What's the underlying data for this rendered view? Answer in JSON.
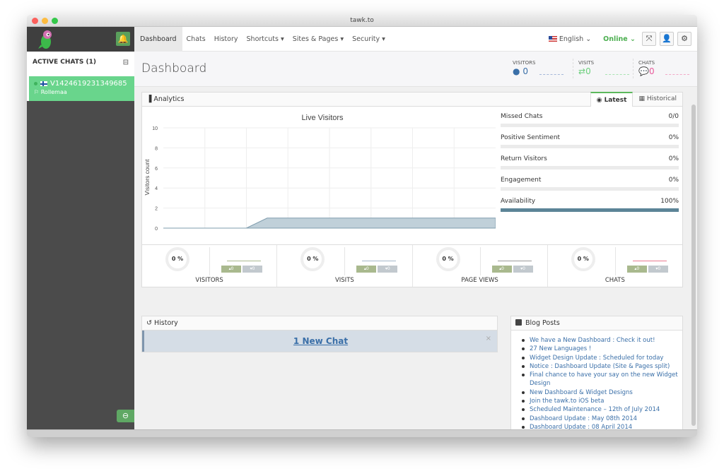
{
  "window": {
    "title": "tawk.to"
  },
  "sidebar": {
    "active_chats_label": "ACTIVE CHATS (1)",
    "chats": [
      {
        "id": "V1424619231349685",
        "location": "Rollemaa"
      }
    ]
  },
  "nav": {
    "items": [
      "Dashboard",
      "Chats",
      "History",
      "Shortcuts ▾",
      "Sites & Pages ▾",
      "Security ▾"
    ],
    "language": "English ⌄",
    "status": "Online ⌄"
  },
  "header": {
    "title": "Dashboard",
    "stats": [
      {
        "label": "VISITORS",
        "value": "0",
        "icon": "user-icon",
        "color": "#3a6fa8"
      },
      {
        "label": "VISITS",
        "value": "0",
        "icon": "exchange-icon",
        "color": "#6ccf7c"
      },
      {
        "label": "CHATS",
        "value": "0",
        "icon": "comments-icon",
        "color": "#e85a9b"
      }
    ]
  },
  "analytics": {
    "title": "Analytics",
    "tabs": [
      "Latest",
      "Historical"
    ],
    "metrics": [
      {
        "name": "Missed Chats",
        "value": "0/0",
        "fill": 0
      },
      {
        "name": "Positive Sentiment",
        "value": "0%",
        "fill": 0
      },
      {
        "name": "Return Visitors",
        "value": "0%",
        "fill": 0
      },
      {
        "name": "Engagement",
        "value": "0%",
        "fill": 0
      },
      {
        "name": "Availability",
        "value": "100%",
        "fill": 100
      }
    ],
    "summary": [
      {
        "label": "VISITORS",
        "percent": "0 %",
        "up": "▴0",
        "down": "▾0",
        "line_color": "#a9b98e"
      },
      {
        "label": "VISITS",
        "percent": "0 %",
        "up": "▴0",
        "down": "▾0",
        "line_color": "#a5b7c9"
      },
      {
        "label": "PAGE VIEWS",
        "percent": "0 %",
        "up": "▴0",
        "down": "▾0",
        "line_color": "#999999"
      },
      {
        "label": "CHATS",
        "percent": "0 %",
        "up": "▴0",
        "down": "▾0",
        "line_color": "#e8798f"
      }
    ]
  },
  "chart_data": {
    "type": "area",
    "title": "Live Visitors",
    "xlabel": "",
    "ylabel": "Visitors count",
    "ylim": [
      0,
      10
    ],
    "yticks": [
      0,
      2,
      4,
      6,
      8,
      10
    ],
    "x": [
      0,
      1,
      2,
      3,
      4,
      5,
      6,
      7,
      8,
      9,
      10,
      11,
      12,
      13,
      14,
      15,
      16
    ],
    "values": [
      0,
      0,
      0,
      0,
      0,
      1,
      1,
      1,
      1,
      1,
      1,
      1,
      1,
      1,
      1,
      1,
      1
    ],
    "grid": true,
    "color": "#5c8497"
  },
  "history": {
    "title": "History",
    "banner": "1 New Chat"
  },
  "blog": {
    "title": "Blog Posts",
    "posts": [
      "We have a New Dashboard : Check it out!",
      "27 New Languages !",
      "Widget Design Update : Scheduled for today",
      "Notice : Dashboard Update (Site & Pages split)",
      "Final chance to have your say on the new Widget Design",
      "New Dashboard & Widget Designs",
      "Join the tawk.to iOS beta",
      "Scheduled Maintenance – 12th of July 2014",
      "Dashboard Update : May 08th 2014",
      "Dashboard Update : 08 April 2014"
    ]
  }
}
